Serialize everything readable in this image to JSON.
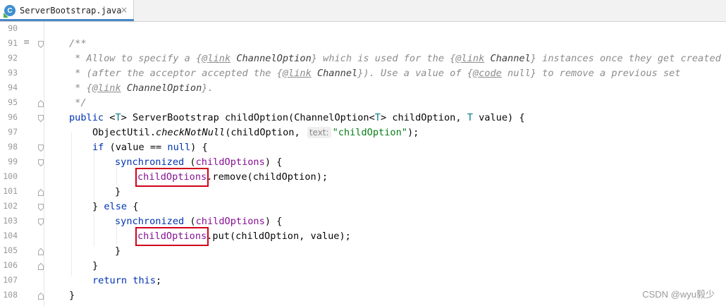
{
  "tab": {
    "file_icon_letter": "C",
    "file_name": "ServerBootstrap.java",
    "close_glyph": "×"
  },
  "gutter": {
    "lines": [
      "90",
      "91",
      "92",
      "93",
      "94",
      "95",
      "96",
      "97",
      "98",
      "99",
      "100",
      "101",
      "102",
      "103",
      "104",
      "105",
      "106",
      "107",
      "108"
    ],
    "doc_marker": "≡"
  },
  "code": {
    "l91": "/**",
    "l92": {
      "a": " * Allow to specify a {",
      "link1": "@link",
      "ref1": "ChannelOption",
      "b": "} which is used for the {",
      "link2": "@link",
      "ref2": "Channel",
      "c": "} instances once they get created"
    },
    "l93": {
      "a": " * (after the acceptor accepted the {",
      "link1": "@link",
      "ref1": "Channel",
      "b": "}). Use a value of {",
      "code": "@code",
      "c": " null} to remove a previous set"
    },
    "l94": {
      "a": " * {",
      "link": "@link",
      "ref": "ChannelOption",
      "b": "}."
    },
    "l95": " */",
    "l96": {
      "kw_public": "public",
      "open": "<",
      "tp1": "T",
      "close": "> ServerBootstrap childOption(ChannelOption<",
      "tp2": "T",
      "rest": "> childOption, ",
      "tp3": "T",
      "end": " value) {"
    },
    "l97": {
      "a": "ObjectUtil.",
      "method": "checkNotNull",
      "b": "(childOption, ",
      "hint": "text:",
      "str": "\"childOption\"",
      "c": ");"
    },
    "l98": {
      "kw_if": "if",
      "a": " (value == ",
      "kw_null": "null",
      "b": ") {"
    },
    "l99": {
      "kw_sync": "synchronized",
      "a": " (",
      "fld": "childOptions",
      "b": ") {"
    },
    "l100": {
      "fld": "childOptions",
      "rest": ".remove(childOption);"
    },
    "l101": "}",
    "l102": {
      "a": "} ",
      "kw_else": "else",
      "b": " {"
    },
    "l103": {
      "kw_sync": "synchronized",
      "a": " (",
      "fld": "childOptions",
      "b": ") {"
    },
    "l104": {
      "fld": "childOptions",
      "rest": ".put(childOption, value);"
    },
    "l105": "}",
    "l106": "}",
    "l107": {
      "kw_return": "return",
      "sp": " ",
      "kw_this": "this",
      "semi": ";"
    },
    "l108": "}"
  },
  "watermark": "CSDN @wyu毅少",
  "colors": {
    "keyword": "#0033b3",
    "field": "#871094",
    "string": "#067d17",
    "comment": "#8c8c8c",
    "highlight_box": "#d0021b",
    "tab_accent": "#4a88c7"
  }
}
